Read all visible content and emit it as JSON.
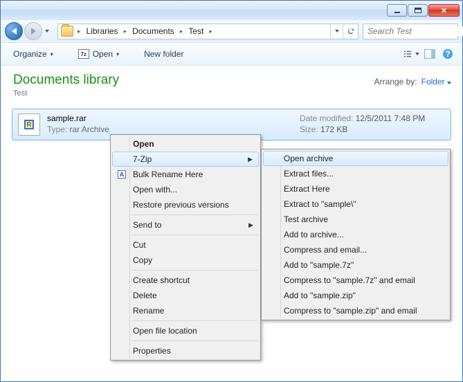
{
  "breadcrumb": {
    "segs": [
      "Libraries",
      "Documents",
      "Test"
    ]
  },
  "search": {
    "placeholder": "Search Test"
  },
  "toolbar": {
    "organize": "Organize",
    "open": "Open",
    "newfolder": "New folder"
  },
  "header": {
    "title": "Documents library",
    "subtitle": "Test",
    "arrange_label": "Arrange by:",
    "arrange_value": "Folder"
  },
  "file": {
    "name": "sample.rar",
    "type_label": "Type:",
    "type_value": "rar Archive",
    "mod_label": "Date modified:",
    "mod_value": "12/5/2011 7:48 PM",
    "size_label": "Size:",
    "size_value": "172 KB"
  },
  "ctx1": {
    "open": "Open",
    "sevenzip": "7-Zip",
    "bulk_rename": "Bulk Rename Here",
    "open_with": "Open with...",
    "restore": "Restore previous versions",
    "send_to": "Send to",
    "cut": "Cut",
    "copy": "Copy",
    "shortcut": "Create shortcut",
    "delete": "Delete",
    "rename": "Rename",
    "open_loc": "Open file location",
    "properties": "Properties"
  },
  "ctx2": {
    "open_archive": "Open archive",
    "extract_files": "Extract files...",
    "extract_here": "Extract Here",
    "extract_to": "Extract to \"sample\\\"",
    "test_archive": "Test archive",
    "add_to_archive": "Add to archive...",
    "compress_email": "Compress and email...",
    "add_7z": "Add to \"sample.7z\"",
    "compress_7z_email": "Compress to \"sample.7z\" and email",
    "add_zip": "Add to \"sample.zip\"",
    "compress_zip_email": "Compress to \"sample.zip\" and email"
  }
}
